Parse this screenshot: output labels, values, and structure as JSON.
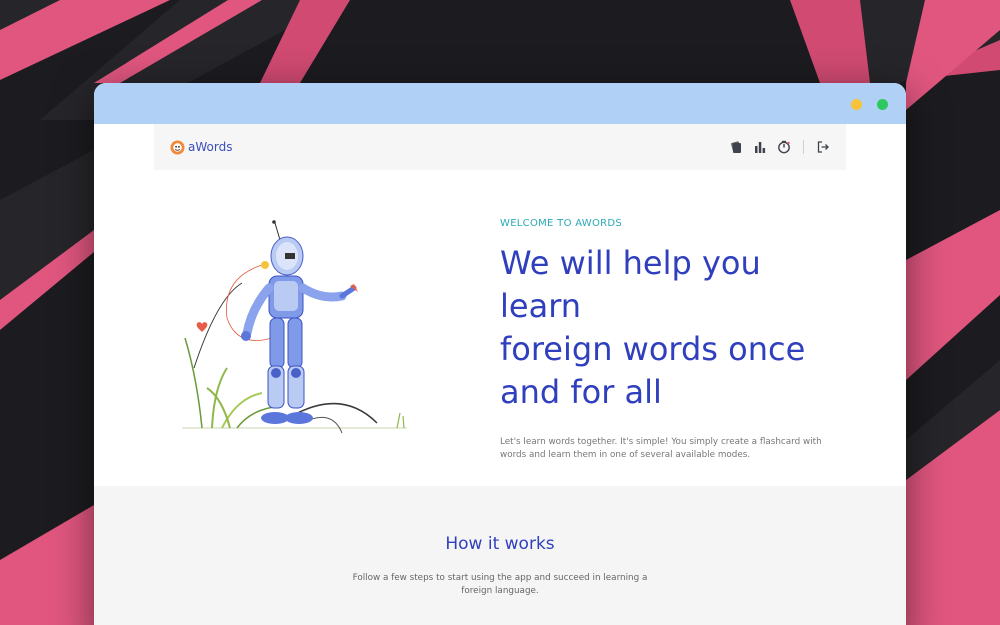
{
  "app": {
    "brand_name": "aWords"
  },
  "nav": {
    "icons": [
      "flashcards-icon",
      "stats-icon",
      "progress-icon",
      "logout-icon"
    ]
  },
  "hero": {
    "eyebrow": "WELCOME TO AWORDS",
    "headline_lines": [
      "We will help you learn",
      "foreign words once",
      "and for all"
    ],
    "lead": "Let's learn words together. It's simple! You simply create a flashcard with words and learn them in one of several available modes."
  },
  "how_it_works": {
    "title": "How it works",
    "text": "Follow a few steps to start using the app and succeed in learning a foreign language."
  },
  "colors": {
    "accent": "#2f3fbd",
    "teal": "#2ba9b4",
    "titlebar": "#b0d0f6",
    "pink": "#e0567f",
    "background": "#1c1b1f"
  }
}
